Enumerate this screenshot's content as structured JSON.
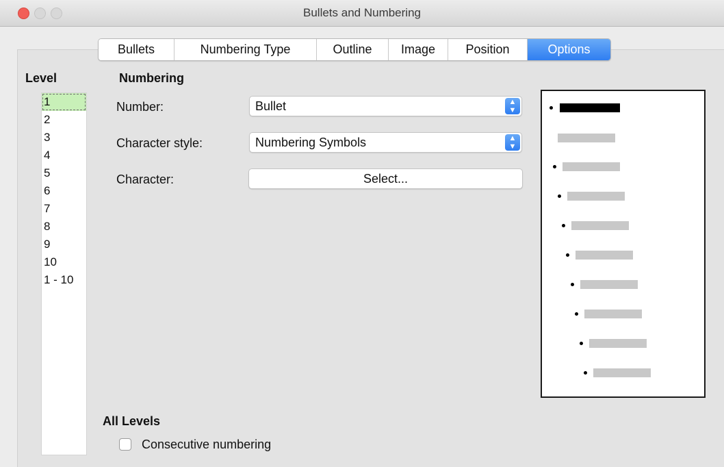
{
  "window": {
    "title": "Bullets and Numbering"
  },
  "tabs": [
    {
      "label": "Bullets",
      "active": false
    },
    {
      "label": "Numbering Type",
      "active": false
    },
    {
      "label": "Outline",
      "active": false
    },
    {
      "label": "Image",
      "active": false
    },
    {
      "label": "Position",
      "active": false
    },
    {
      "label": "Options",
      "active": true
    }
  ],
  "level": {
    "label": "Level",
    "items": [
      "1",
      "2",
      "3",
      "4",
      "5",
      "6",
      "7",
      "8",
      "9",
      "10",
      "1 - 10"
    ],
    "selected_index": 0
  },
  "numbering": {
    "title": "Numbering",
    "number_label": "Number:",
    "number_value": "Bullet",
    "char_style_label": "Character style:",
    "char_style_value": "Numbering Symbols",
    "character_label": "Character:",
    "select_button": "Select..."
  },
  "all_levels": {
    "title": "All Levels",
    "consecutive_label": "Consecutive numbering",
    "consecutive_checked": false
  },
  "colors": {
    "accent": "#2f7ef1",
    "selected_level_bg": "#c8f0b8",
    "preview_active": "#000000",
    "preview_inactive": "#c8c8c8"
  }
}
